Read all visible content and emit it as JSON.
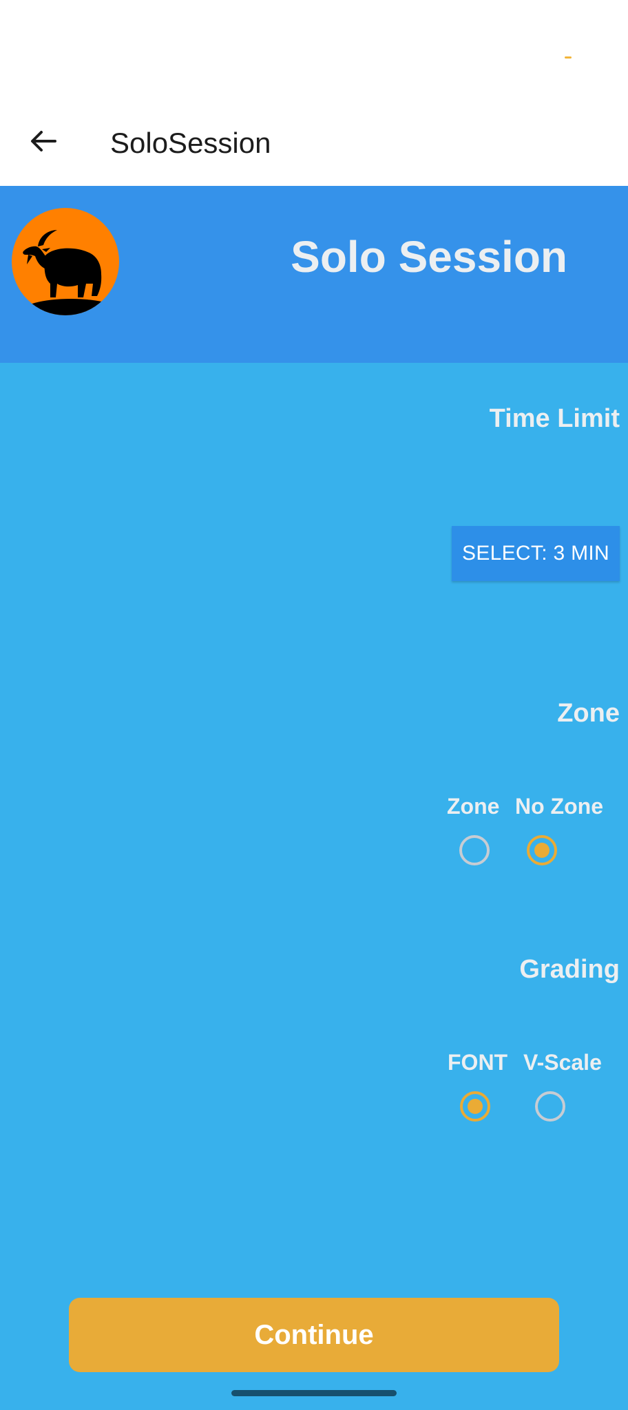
{
  "app_bar": {
    "title": "SoloSession"
  },
  "header": {
    "title": "Solo Session"
  },
  "time_limit": {
    "label": "Time Limit",
    "button_label": "SELECT: 3 MIN"
  },
  "zone": {
    "label": "Zone",
    "options": [
      {
        "label": "Zone",
        "selected": false
      },
      {
        "label": "No Zone",
        "selected": true
      }
    ]
  },
  "grading": {
    "label": "Grading",
    "options": [
      {
        "label": "FONT",
        "selected": true
      },
      {
        "label": "V-Scale",
        "selected": false
      }
    ]
  },
  "continue": {
    "label": "Continue"
  },
  "colors": {
    "header_band": "#3592ea",
    "main_bg": "#38b1ec",
    "accent": "#e8ab38",
    "logo_bg": "#ff8000"
  },
  "icons": {
    "back": "arrow-left-icon",
    "logo": "goat-logo"
  }
}
